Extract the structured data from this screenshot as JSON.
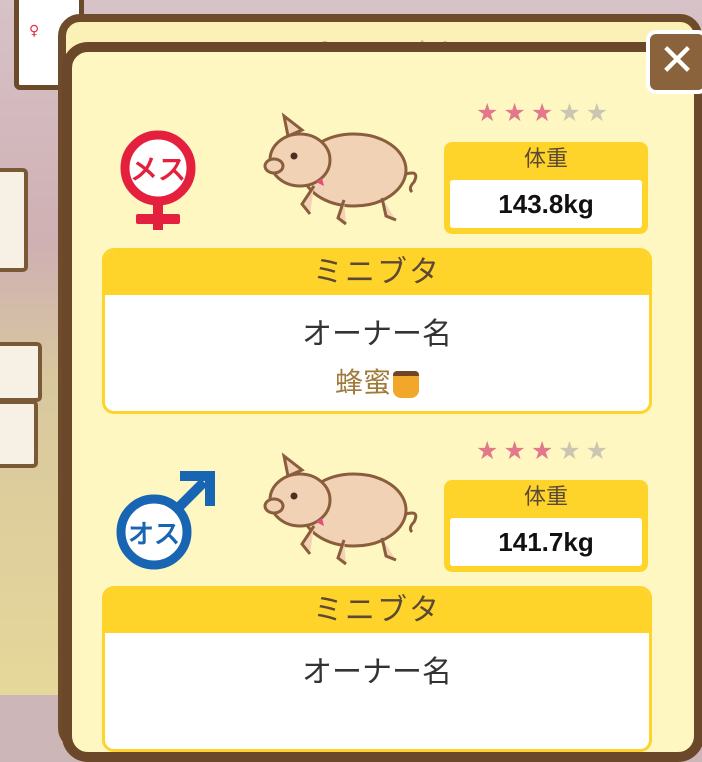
{
  "dialog": {
    "close_label": "✕",
    "back_title": "パコ子饭"
  },
  "pigs": [
    {
      "stars": {
        "rating": 3,
        "max": 5,
        "on_glyphs": "★★★",
        "off_glyphs": "★★"
      },
      "gender_label": "メス",
      "gender_icon": "female-symbol-icon",
      "weight_label": "体重",
      "weight_value": "143.8kg",
      "breed": "ミニブタ",
      "owner_label": "オーナー名",
      "owner_name": "蜂蜜"
    },
    {
      "stars": {
        "rating": 3,
        "max": 5,
        "on_glyphs": "★★★",
        "off_glyphs": "★★"
      },
      "gender_label": "オス",
      "gender_icon": "male-symbol-icon",
      "weight_label": "体重",
      "weight_value": "141.7kg",
      "breed": "ミニブタ",
      "owner_label": "オーナー名",
      "owner_name": ""
    }
  ],
  "colors": {
    "frame": "#6b4829",
    "panel": "#fef7c2",
    "header_yellow": "#ffd42a",
    "female": "#e5203e",
    "male": "#1865b4",
    "star_on": "#e2788a",
    "star_off": "#cbc5b1"
  }
}
